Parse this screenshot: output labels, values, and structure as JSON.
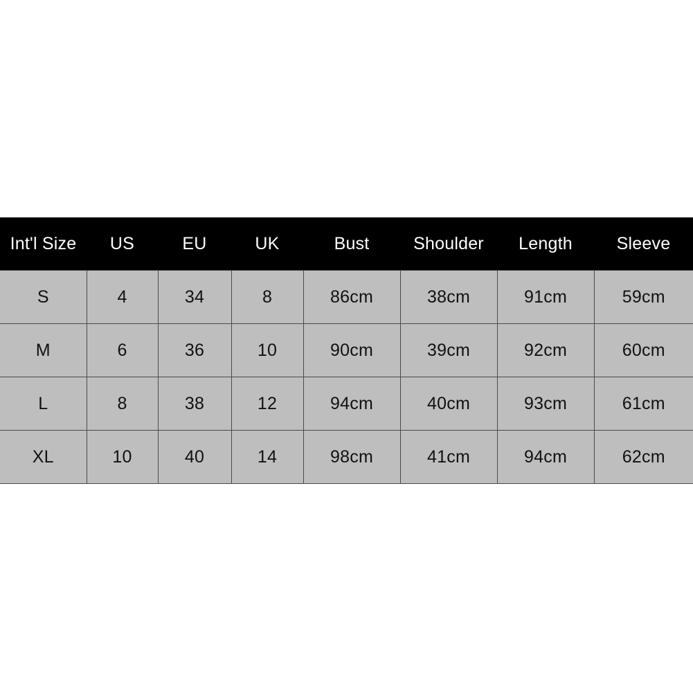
{
  "table": {
    "name": "size-chart",
    "header_background": "#000000",
    "header_text_color": "#ffffff",
    "cell_background": "#bebebe",
    "cell_text_color": "#111111",
    "border_color": "#4a4a4a",
    "columns": [
      "Int'l Size",
      "US",
      "EU",
      "UK",
      "Bust",
      "Shoulder",
      "Length",
      "Sleeve"
    ],
    "rows": [
      {
        "intl_size": "S",
        "us": "4",
        "eu": "34",
        "uk": "8",
        "bust": "86cm",
        "shoulder": "38cm",
        "length": "91cm",
        "sleeve": "59cm"
      },
      {
        "intl_size": "M",
        "us": "6",
        "eu": "36",
        "uk": "10",
        "bust": "90cm",
        "shoulder": "39cm",
        "length": "92cm",
        "sleeve": "60cm"
      },
      {
        "intl_size": "L",
        "us": "8",
        "eu": "38",
        "uk": "12",
        "bust": "94cm",
        "shoulder": "40cm",
        "length": "93cm",
        "sleeve": "61cm"
      },
      {
        "intl_size": "XL",
        "us": "10",
        "eu": "40",
        "uk": "14",
        "bust": "98cm",
        "shoulder": "41cm",
        "length": "94cm",
        "sleeve": "62cm"
      }
    ]
  }
}
